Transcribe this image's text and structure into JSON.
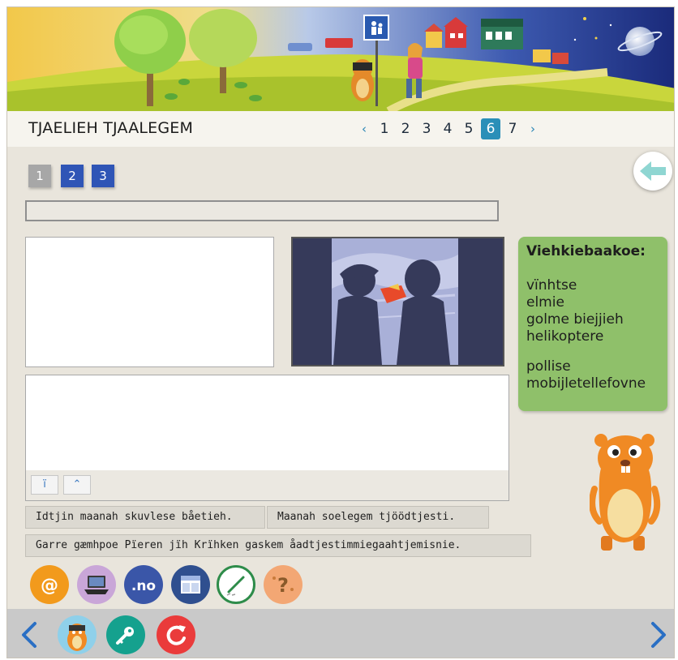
{
  "header": {
    "title": "TJAELIEH TJAALEGEM",
    "pages": [
      "1",
      "2",
      "3",
      "4",
      "5",
      "6",
      "7"
    ],
    "active_page": "6",
    "prev_symbol": "‹",
    "next_symbol": "›"
  },
  "subtabs": [
    "1",
    "2",
    "3"
  ],
  "vocabulary": {
    "title": "Viehkiebaakoe:",
    "group1": [
      "vïnhtse",
      "elmie",
      "golme biejjieh",
      "helikoptere"
    ],
    "group2": [
      "pollise",
      "mobijletellefovne"
    ]
  },
  "editor_tools": {
    "tool1": "ï",
    "tool2": "⌃"
  },
  "sentences": [
    "Idtjin maanah skuvlese båetieh.",
    "Maanah soelegem tjöödtjesti.",
    "Garre gæmhpoe Pïeren jïh Krïhken gaskem åadtjestimmiegaahtjemisnie."
  ],
  "tool_icons": [
    "email-icon",
    "laptop-icon",
    "no-domain-icon",
    "layout-icon",
    "pencil-icon",
    "help-icon"
  ],
  "tool_labels": {
    "email": "@",
    "no": ".no",
    "help": "?"
  },
  "footer_icons": [
    "prev-arrow-icon",
    "mascot-icon",
    "key-icon",
    "reload-icon",
    "next-arrow-icon"
  ],
  "colors": {
    "accent_blue": "#2f55b6",
    "active_page": "#2a8fb8",
    "vocab_green": "#8fc06a",
    "footer_gray": "#c9c9c9"
  }
}
